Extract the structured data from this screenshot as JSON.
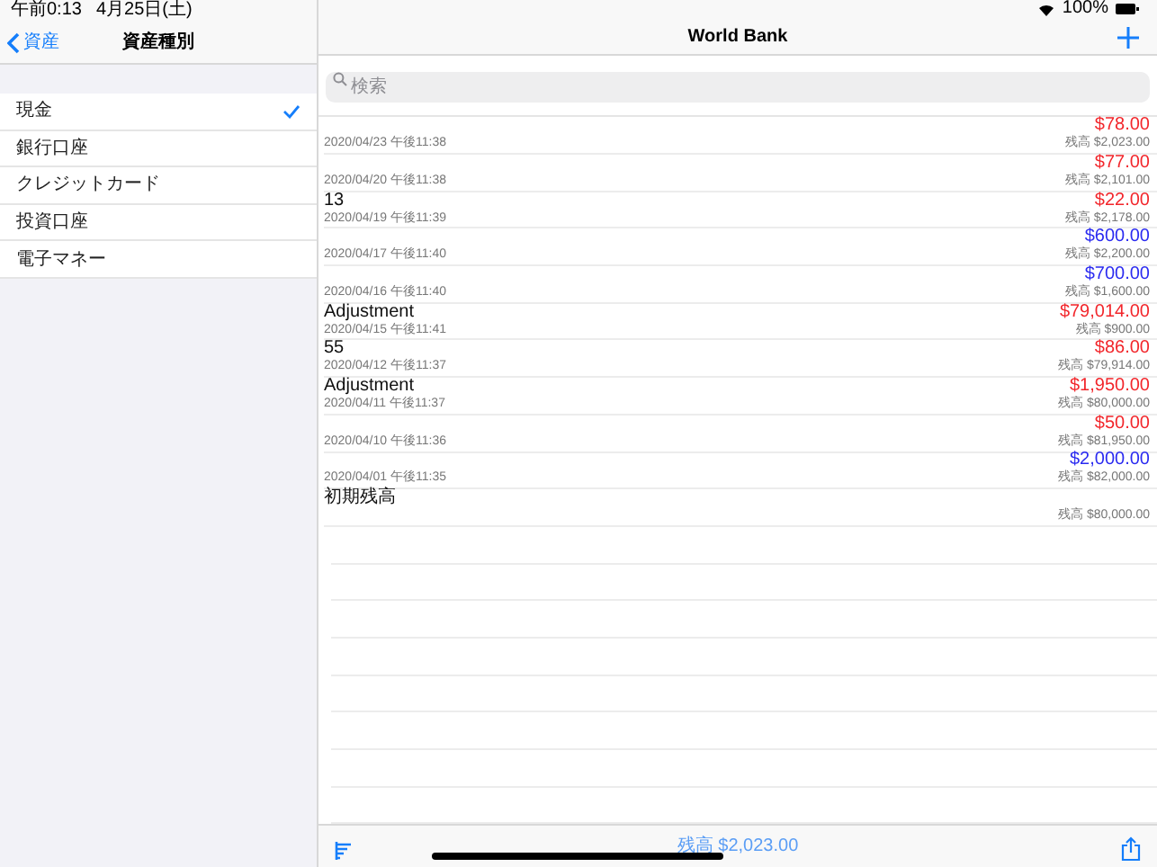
{
  "status_bar": {
    "time": "午前0:13",
    "date": "4月25日(土)",
    "battery": "100%"
  },
  "sidebar": {
    "back": "資産",
    "title": "資産種別",
    "items": [
      {
        "label": "現金",
        "selected": true
      },
      {
        "label": "銀行口座",
        "selected": false
      },
      {
        "label": "クレジットカード",
        "selected": false
      },
      {
        "label": "投資口座",
        "selected": false
      },
      {
        "label": "電子マネー",
        "selected": false
      }
    ]
  },
  "main": {
    "title": "World Bank",
    "search": {
      "placeholder": "検索"
    },
    "transactions": [
      {
        "amount": "$78.00",
        "kind": "expense",
        "date": "2020/04/23 午後11:38",
        "balance": "残高 $2,023.00"
      },
      {
        "amount": "$77.00",
        "kind": "expense",
        "date": "2020/04/20 午後11:38",
        "balance": "残高 $2,101.00"
      },
      {
        "memo": "13",
        "amount": "$22.00",
        "kind": "expense",
        "date": "2020/04/19 午後11:39",
        "balance": "残高 $2,178.00"
      },
      {
        "amount": "$600.00",
        "kind": "income",
        "date": "2020/04/17 午後11:40",
        "balance": "残高 $2,200.00"
      },
      {
        "amount": "$700.00",
        "kind": "income",
        "date": "2020/04/16 午後11:40",
        "balance": "残高 $1,600.00"
      },
      {
        "memo": "Adjustment",
        "amount": "$79,014.00",
        "kind": "expense",
        "date": "2020/04/15 午後11:41",
        "balance": "残高 $900.00"
      },
      {
        "memo": "55",
        "amount": "$86.00",
        "kind": "expense",
        "date": "2020/04/12 午後11:37",
        "balance": "残高 $79,914.00"
      },
      {
        "memo": "Adjustment",
        "amount": "$1,950.00",
        "kind": "expense",
        "date": "2020/04/11 午後11:37",
        "balance": "残高 $80,000.00"
      },
      {
        "amount": "$50.00",
        "kind": "expense",
        "date": "2020/04/10 午後11:36",
        "balance": "残高 $81,950.00"
      },
      {
        "amount": "$2,000.00",
        "kind": "income",
        "date": "2020/04/01 午後11:35",
        "balance": "残高 $82,000.00"
      },
      {
        "memo": "初期残高",
        "balance": "残高 $80,000.00"
      }
    ],
    "footer_balance": "残高 $2,023.00"
  }
}
